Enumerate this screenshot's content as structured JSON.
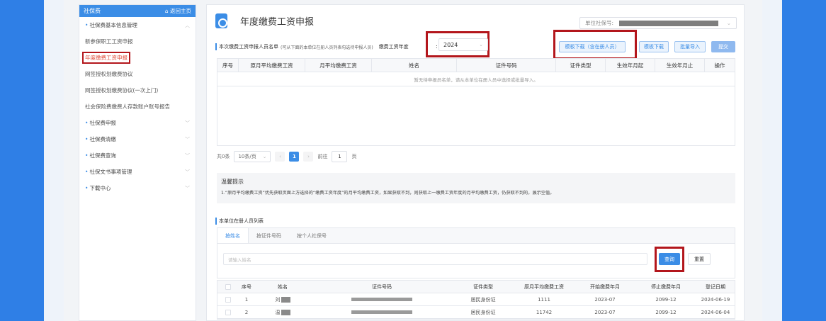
{
  "sidebar": {
    "header_title": "社保费",
    "home_link": "返回主页",
    "items": [
      {
        "label": "社保费基本信息管理",
        "group": true
      },
      {
        "label": "新参保职工工资申报",
        "group": false
      },
      {
        "label": "年度缴费工资申报",
        "group": false
      },
      {
        "label": "网签授权划缴费协议",
        "group": false
      },
      {
        "label": "网签授权划缴费协议(一次上门)",
        "group": false
      },
      {
        "label": "社会保险费缴费人存款账户账号报告",
        "group": false
      },
      {
        "label": "社保费申报",
        "group": true
      },
      {
        "label": "社保费清缴",
        "group": true
      },
      {
        "label": "社保费查询",
        "group": true
      },
      {
        "label": "社保文书事项管理",
        "group": true
      },
      {
        "label": "下载中心",
        "group": true
      }
    ]
  },
  "page": {
    "title": "年度缴费工资申报",
    "unit_label": "单位社保号:"
  },
  "list_section": {
    "title": "本次缴费工资申报人员名单",
    "hint": "(可从下面的本单位在册人员列表勾选待申报人员)",
    "year_label": "缴费工资年度",
    "year_colon": ":",
    "year_value": "2024"
  },
  "buttons": {
    "template_download_registered": "模板下载（含在册人员）",
    "template_download": "模板下载",
    "batch_import": "批量导入",
    "submit": "提交"
  },
  "declare_table": {
    "columns": [
      "序号",
      "原月平均缴费工资",
      "月平均缴费工资",
      "姓名",
      "证件号码",
      "证件类型",
      "生效年月起",
      "生效年月止",
      "操作"
    ],
    "empty_text": "暂无待申报员名单，请从本单位在册人员中选择或批量导入。"
  },
  "pagination": {
    "total": "共0条",
    "page_size": "10条/页",
    "current_page": "1",
    "goto_label": "前往",
    "goto_value": "1",
    "page_unit": "页"
  },
  "tips": {
    "title": "温馨提示",
    "text": "1.“原月平均缴费工资”优先获取页面上方选择的“缴费工资年度”的月平均缴费工资，如果获取不到，则获取上一缴费工资年度的月平均缴费工资，仍获取不到的，展示空值。"
  },
  "registered_section": {
    "title": "本单位在册人员列表",
    "tabs": [
      "按姓名",
      "按证件号码",
      "按个人社保号"
    ],
    "name_placeholder": "请输入姓名",
    "query_button": "查询",
    "reset_button": "重置"
  },
  "registered_table": {
    "columns": [
      "序号",
      "姓名",
      "证件号码",
      "证件类型",
      "原月平均缴费工资",
      "开始缴费年月",
      "停止缴费年月",
      "登记日期"
    ],
    "rows": [
      {
        "no": "1",
        "name": "刘",
        "id_type": "居民身份证",
        "salary": "1111",
        "start": "2023-07",
        "stop": "2099-12",
        "reg_date": "2024-06-19"
      },
      {
        "no": "2",
        "name": "温",
        "id_type": "居民身份证",
        "salary": "11742",
        "start": "2023-07",
        "stop": "2099-12",
        "reg_date": "2024-06-04"
      }
    ]
  },
  "colors": {
    "primary": "#3b8de6",
    "highlight_red": "#b3161c",
    "band_blue": "#2f7fe6"
  }
}
